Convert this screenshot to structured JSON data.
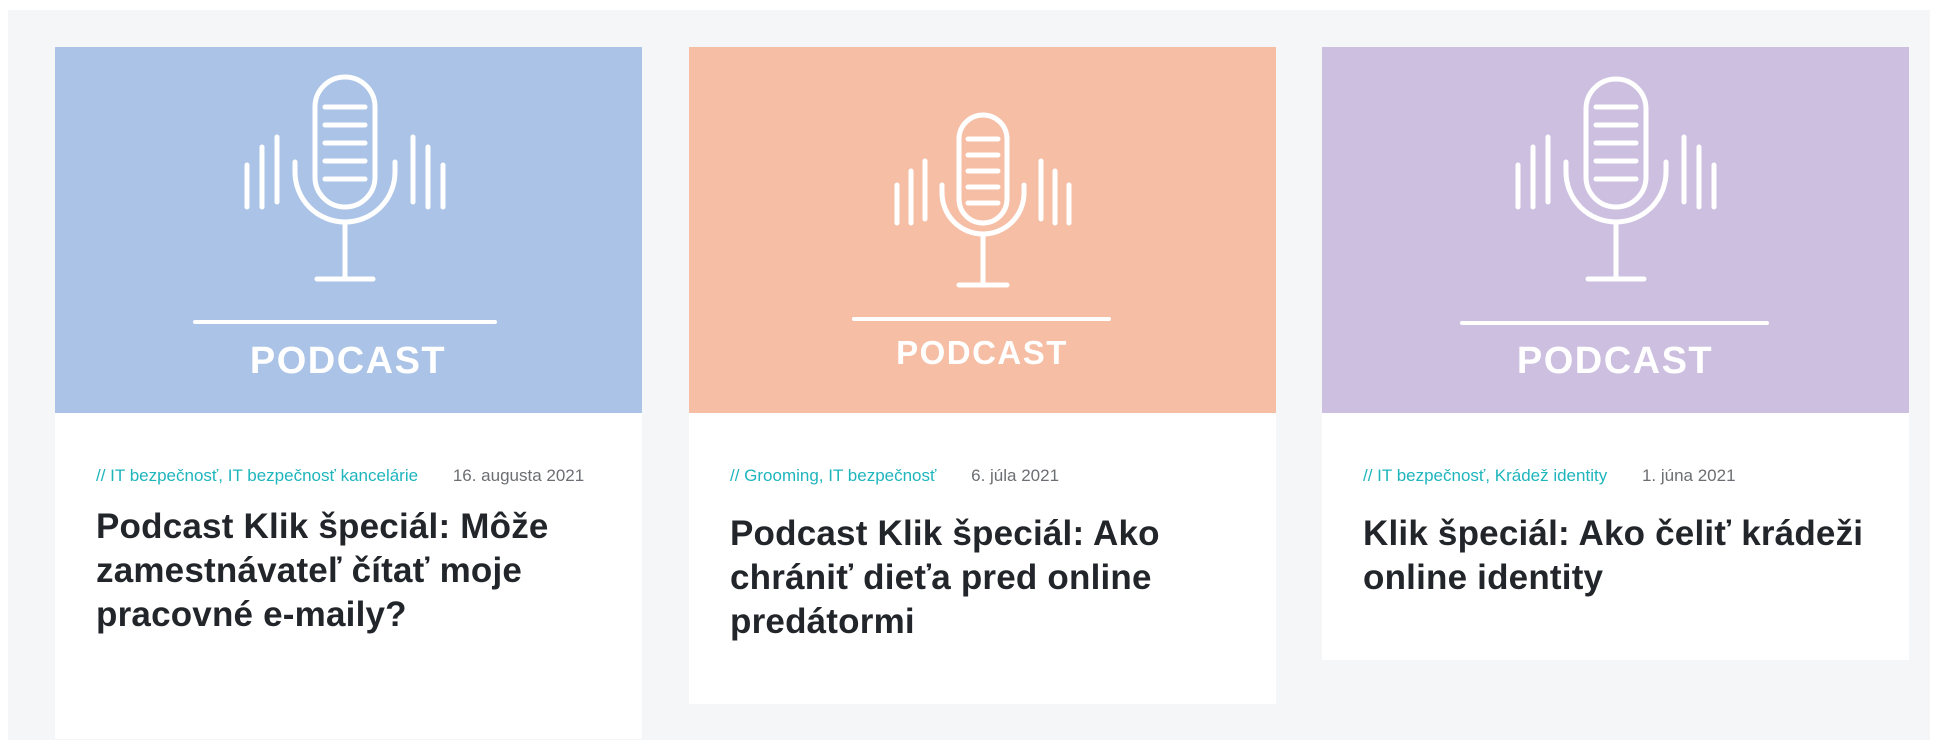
{
  "colors": {
    "accent_category": "#1fb5bd",
    "title_text": "#22262b",
    "page_background": "#f4f6f8"
  },
  "cards": [
    {
      "thumb_color": "#aac3e6",
      "thumb_label": "PODCAST",
      "thumb_icon": "microphone-soundwave-icon",
      "categories": "// IT bezpečnosť, IT bezpečnosť kancelárie",
      "date": "16. augusta 2021",
      "title": "Podcast Klik špeciál: Môže zamestnávateľ čítať moje pracovné e-maily?"
    },
    {
      "thumb_color": "#f5bea5",
      "thumb_label": "PODCAST",
      "thumb_icon": "microphone-soundwave-icon",
      "categories": "// Grooming, IT bezpečnosť",
      "date": "6. júla 2021",
      "title": "Podcast Klik špeciál: Ako chrániť dieťa pred online predátormi"
    },
    {
      "thumb_color": "#ccbfe0",
      "thumb_label": "PODCAST",
      "thumb_icon": "microphone-soundwave-icon",
      "categories": "// IT bezpečnosť, Krádež identity",
      "date": "1. júna 2021",
      "title": "Klik špeciál: Ako čeliť krádeži online identity"
    }
  ]
}
